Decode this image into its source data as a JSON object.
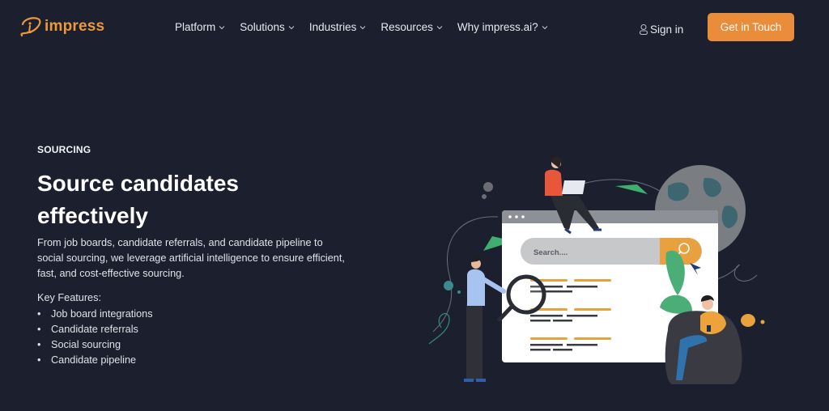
{
  "header": {
    "logo_text": "impress",
    "nav": [
      {
        "label": "Platform",
        "icon": "chevron-down-icon"
      },
      {
        "label": "Solutions",
        "icon": "chevron-down-icon"
      },
      {
        "label": "Industries",
        "icon": "chevron-down-icon"
      },
      {
        "label": "Resources",
        "icon": "chevron-down-icon"
      },
      {
        "label": "Why impress.ai?",
        "icon": "chevron-down-icon"
      }
    ],
    "signin_label": "Sign in",
    "signin_icon": "user-icon",
    "cta_label": "Get in Touch"
  },
  "hero": {
    "eyebrow": "SOURCING",
    "headline": "Source candidates effectively",
    "description": "From job boards, candidate referrals, and candidate pipeline to social sourcing, we leverage artificial intelligence to ensure efficient, fast, and cost-effective sourcing.",
    "features_label": "Key Features:",
    "features": [
      "Job board integrations",
      "Candidate referrals",
      "Social sourcing",
      "Candidate pipeline"
    ]
  },
  "illustration": {
    "search_placeholder": "Search....",
    "search_icon": "search-icon"
  },
  "colors": {
    "background": "#1b1f2e",
    "accent": "#ea8d3a",
    "logo": "#ea9a3a"
  }
}
